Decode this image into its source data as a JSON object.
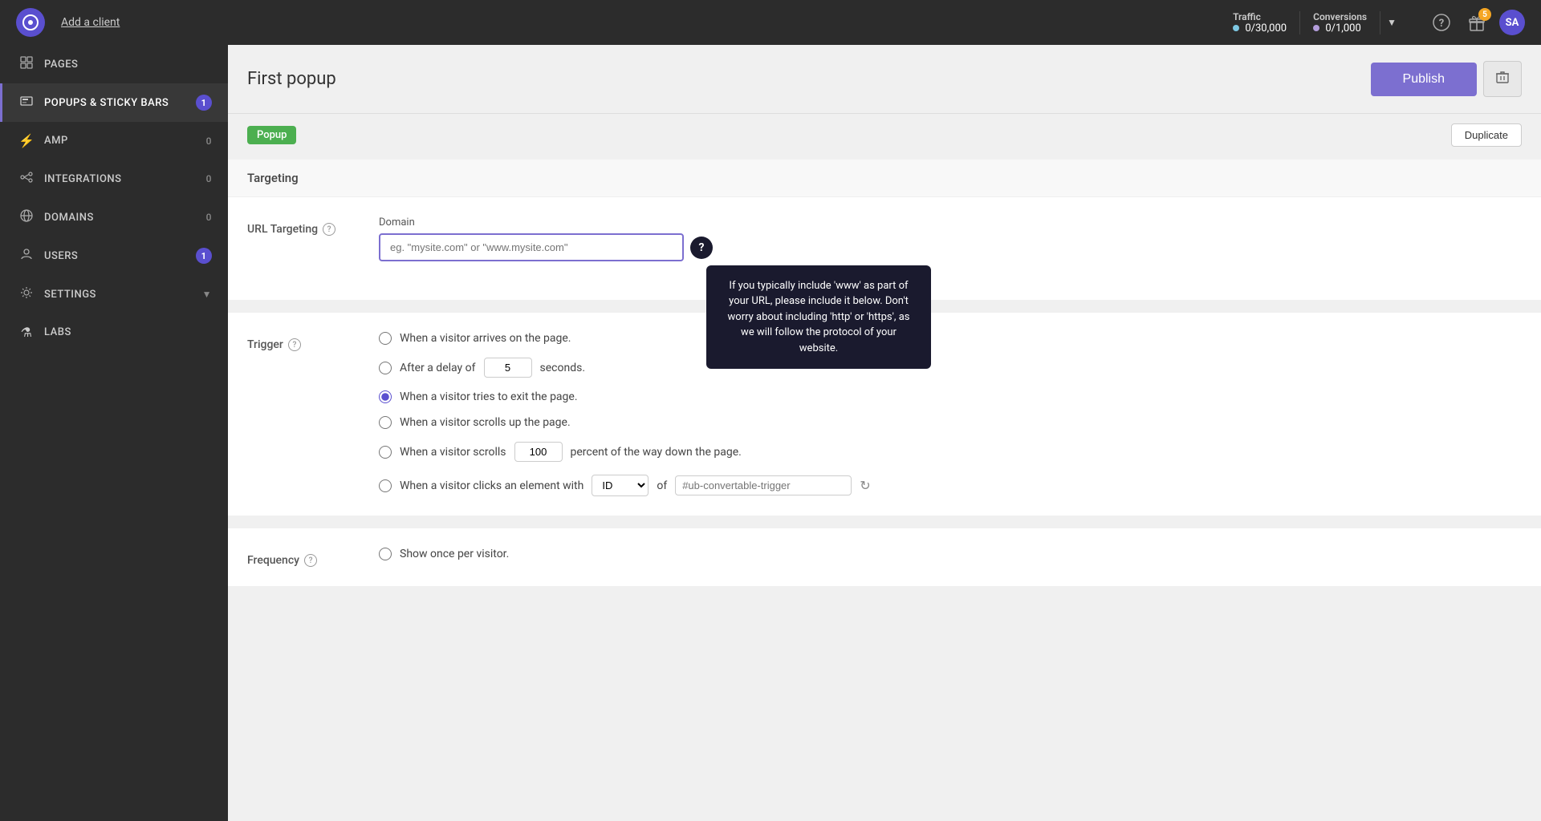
{
  "topbar": {
    "logo_text": "⊙",
    "add_client_label": "Add a client",
    "traffic": {
      "label": "Traffic",
      "value": "0/30,000",
      "dot_color": "#7ec8e3"
    },
    "conversions": {
      "label": "Conversions",
      "value": "0/1,000",
      "dot_color": "#b39ddb"
    },
    "gift_badge": "5",
    "avatar_text": "SA"
  },
  "sidebar": {
    "items": [
      {
        "id": "pages",
        "label": "PAGES",
        "icon": "▦",
        "badge": null
      },
      {
        "id": "popups",
        "label": "POPUPS & STICKY BARS",
        "icon": "◫",
        "badge": "1",
        "active": true
      },
      {
        "id": "amp",
        "label": "AMP",
        "icon": "⚡",
        "badge": "0"
      },
      {
        "id": "integrations",
        "label": "INTEGRATIONS",
        "icon": "✦",
        "badge": "0"
      },
      {
        "id": "domains",
        "label": "DOMAINS",
        "icon": "◎",
        "badge": "0"
      },
      {
        "id": "users",
        "label": "USERS",
        "icon": "👤",
        "badge": "1"
      },
      {
        "id": "settings",
        "label": "SETTINGS",
        "icon": "⚙",
        "badge": null,
        "has_chevron": true
      },
      {
        "id": "labs",
        "label": "LABS",
        "icon": "⚗",
        "badge": null
      }
    ]
  },
  "page": {
    "title": "First popup",
    "publish_label": "Publish",
    "delete_icon": "🗑",
    "popup_badge": "Popup",
    "duplicate_label": "Duplicate"
  },
  "targeting": {
    "section_title": "Targeting",
    "url_targeting": {
      "label": "URL Targeting",
      "domain_label": "Domain",
      "placeholder": "eg. \"mysite.com\" or \"www.mysite.com\"",
      "tooltip": "If you typically include 'www' as part of your URL, please include it below. Don't worry about including 'http' or 'https', as we will follow the protocol of your website."
    },
    "trigger": {
      "label": "Trigger",
      "options": [
        {
          "id": "arrives",
          "label": "When a visitor arrives on the page.",
          "selected": false
        },
        {
          "id": "delay",
          "label_prefix": "After a delay of",
          "label_suffix": "seconds.",
          "value": "5",
          "selected": false
        },
        {
          "id": "exit",
          "label": "When a visitor tries to exit the page.",
          "selected": true
        },
        {
          "id": "scrolls_up",
          "label": "When a visitor scrolls up the page.",
          "selected": false
        },
        {
          "id": "scrolls_down",
          "label_prefix": "When a visitor scrolls",
          "label_suffix": "percent of the way down the page.",
          "value": "100",
          "selected": false
        },
        {
          "id": "clicks",
          "label_prefix": "When a visitor clicks an element with",
          "select_value": "ID",
          "label_middle": "of",
          "input_placeholder": "#ub-convertable-trigger",
          "selected": false
        }
      ]
    },
    "frequency": {
      "label": "Frequency",
      "options": [
        {
          "id": "once",
          "label": "Show once per visitor.",
          "selected": false
        }
      ]
    }
  }
}
